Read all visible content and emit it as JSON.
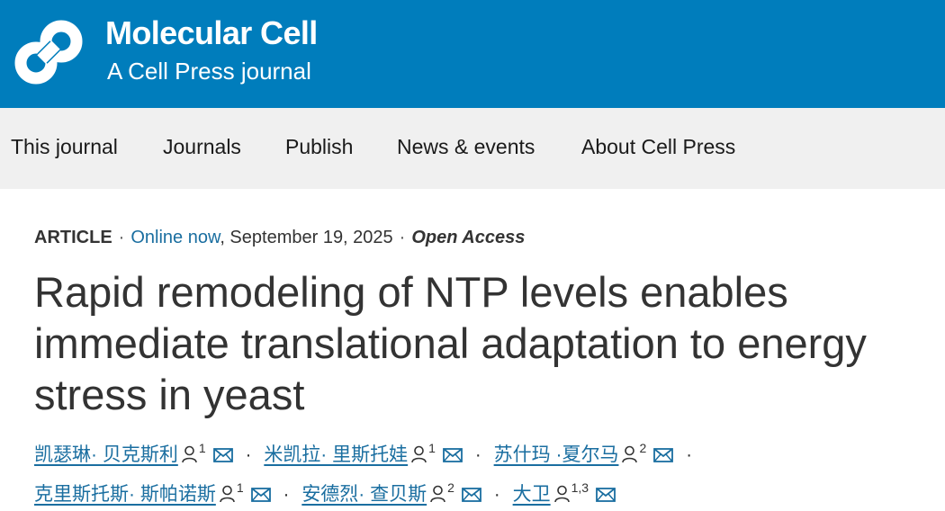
{
  "brand": {
    "journal_name": "Molecular Cell",
    "tagline": "A Cell Press journal",
    "header_color": "#007dbc",
    "logo_icon": "cell-press-logo-icon"
  },
  "nav": {
    "items": [
      {
        "label": "This journal"
      },
      {
        "label": "Journals"
      },
      {
        "label": "Publish"
      },
      {
        "label": "News & events"
      },
      {
        "label": "About Cell Press"
      }
    ]
  },
  "article": {
    "type": "ARTICLE",
    "status": "Online now",
    "date": ", September 19, 2025",
    "access": "Open Access",
    "title": "Rapid remodeling of NTP levels enables immediate translational adaptation to energy stress in yeast",
    "authors": [
      {
        "name": "凯瑟琳· 贝克斯利",
        "aff": "1"
      },
      {
        "name": "米凯拉· 里斯托娃",
        "aff": "1"
      },
      {
        "name": "苏什玛 ·夏尔马",
        "aff": "2"
      },
      {
        "name": "克里斯托斯· 斯帕诺斯",
        "aff": "1"
      },
      {
        "name": "安德烈· 查贝斯",
        "aff": "2"
      },
      {
        "name": "大卫",
        "aff": "1,3"
      }
    ],
    "separator": "·",
    "link_color": "#1a6ea0"
  }
}
